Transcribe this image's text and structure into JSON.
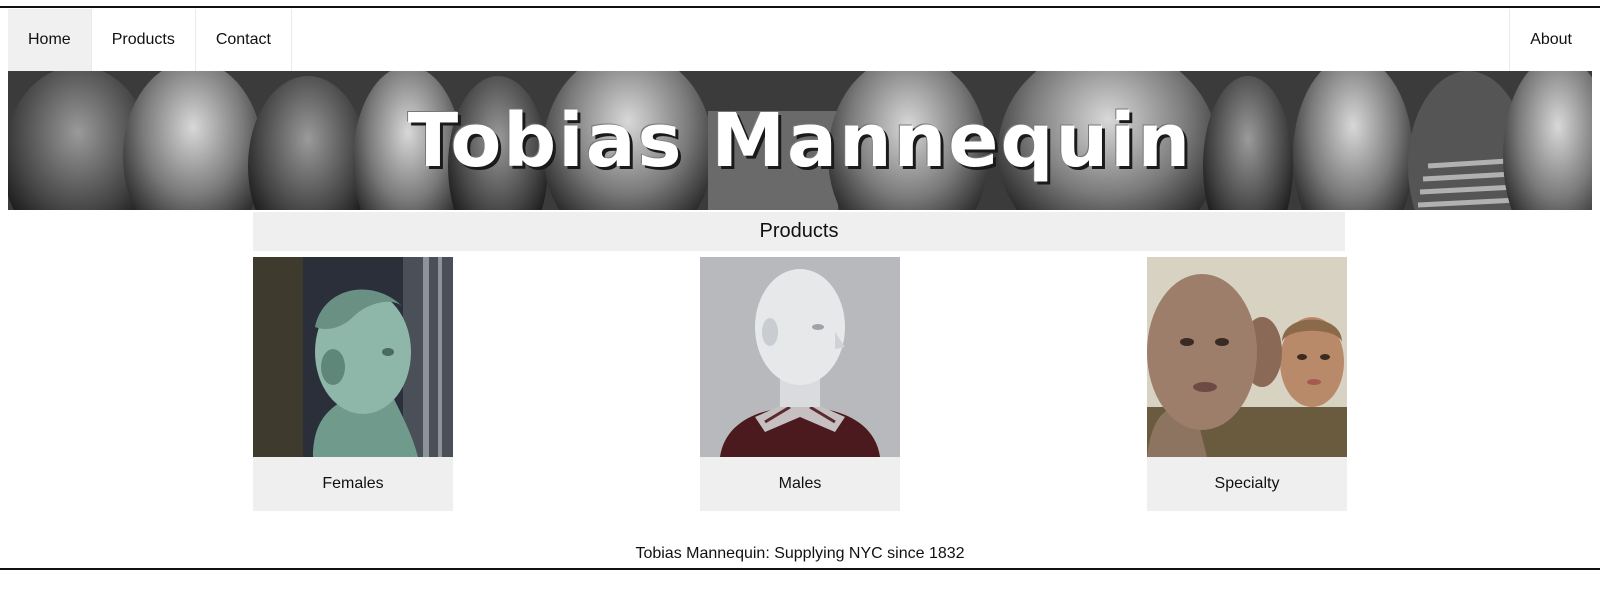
{
  "nav": {
    "items": [
      {
        "label": "Home",
        "active": true
      },
      {
        "label": "Products",
        "active": false
      },
      {
        "label": "Contact",
        "active": false
      }
    ],
    "right_item": {
      "label": "About"
    }
  },
  "banner": {
    "title": "Tobias Mannequin"
  },
  "products": {
    "heading": "Products",
    "cards": [
      {
        "label": "Females",
        "image": "mannequin-head-teal"
      },
      {
        "label": "Males",
        "image": "mannequin-head-white"
      },
      {
        "label": "Specialty",
        "image": "mannequin-heads-tan"
      }
    ]
  },
  "footer": {
    "text": "Tobias Mannequin: Supplying NYC since 1832"
  }
}
